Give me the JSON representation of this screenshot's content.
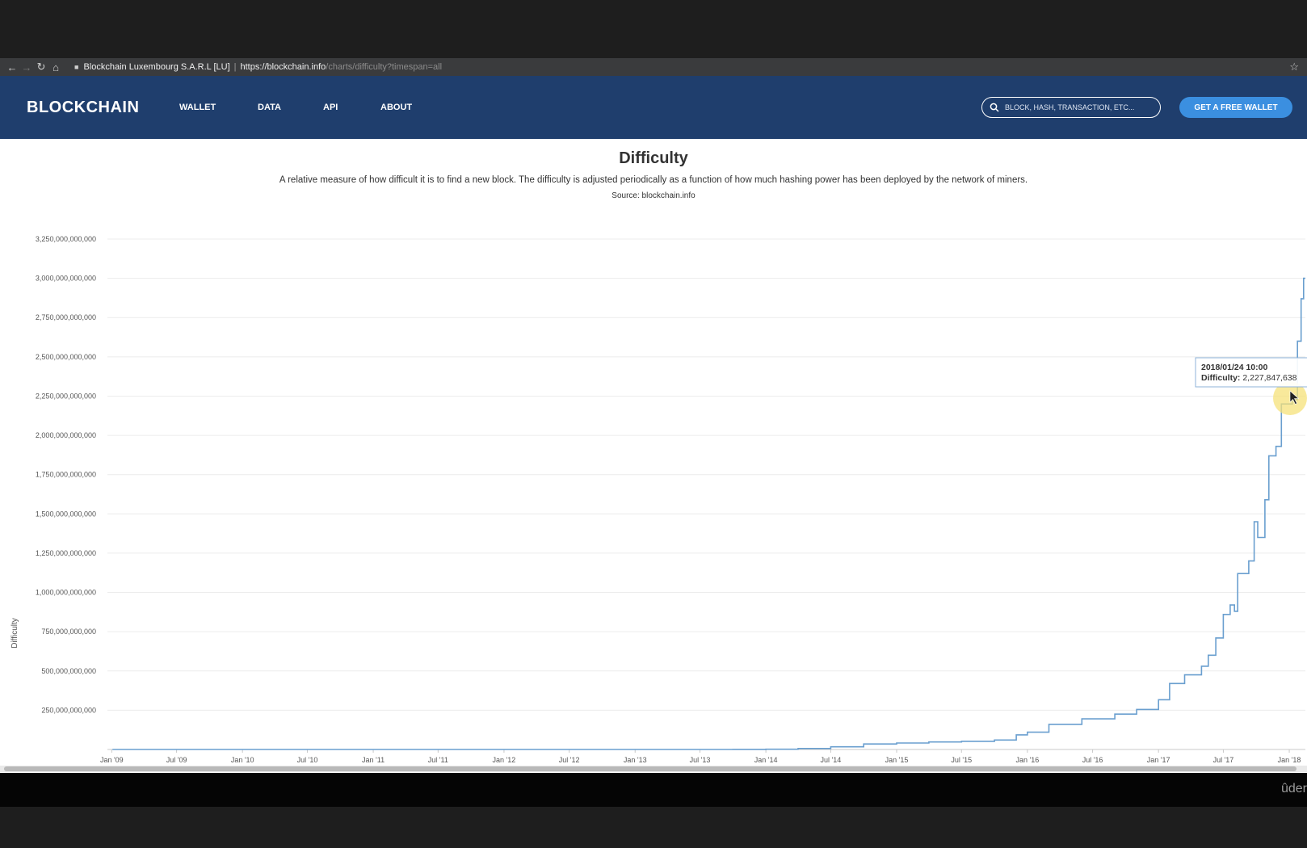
{
  "browser": {
    "site_identity": "Blockchain Luxembourg S.A.R.L [LU]",
    "url_host": "https://blockchain.info",
    "url_path": "/charts/difficulty?timespan=all",
    "back_icon": "arrow-left-icon",
    "forward_icon": "arrow-right-icon",
    "reload_icon": "reload-icon",
    "home_icon": "home-icon",
    "bookmark_icon": "star-icon"
  },
  "header": {
    "logo": "BLOCKCHAIN",
    "nav": [
      {
        "label": "WALLET"
      },
      {
        "label": "DATA"
      },
      {
        "label": "API"
      },
      {
        "label": "ABOUT"
      }
    ],
    "search_placeholder": "BLOCK, HASH, TRANSACTION, ETC...",
    "cta_label": "GET A FREE WALLET",
    "colors": {
      "header_bg": "#1f3e6d",
      "cta_bg": "#3b8fe0"
    }
  },
  "page": {
    "title": "Difficulty",
    "description": "A relative measure of how difficult it is to find a new block. The difficulty is adjusted periodically as a function of how much hashing power has been deployed by the network of miners.",
    "source": "Source: blockchain.info"
  },
  "tooltip": {
    "date": "2018/01/24 10:00",
    "label": "Difficulty:",
    "value": "2,227,847,638"
  },
  "footer": {
    "watermark": "ûder"
  },
  "chart_data": {
    "type": "line",
    "title": "Difficulty",
    "ylabel": "Difficulty",
    "xlabel": "",
    "ylim": [
      0,
      3250000000000
    ],
    "xlim": [
      "2008-12-20",
      "2018-02-15"
    ],
    "grid": true,
    "legend": "none",
    "line_color": "#6a9fcf",
    "y_ticks": [
      {
        "value": 250000000000,
        "label": "250,000,000,000"
      },
      {
        "value": 500000000000,
        "label": "500,000,000,000"
      },
      {
        "value": 750000000000,
        "label": "750,000,000,000"
      },
      {
        "value": 1000000000000,
        "label": "1,000,000,000,000"
      },
      {
        "value": 1250000000000,
        "label": "1,250,000,000,000"
      },
      {
        "value": 1500000000000,
        "label": "1,500,000,000,000"
      },
      {
        "value": 1750000000000,
        "label": "1,750,000,000,000"
      },
      {
        "value": 2000000000000,
        "label": "2,000,000,000,000"
      },
      {
        "value": 2250000000000,
        "label": "2,250,000,000,000"
      },
      {
        "value": 2500000000000,
        "label": "2,500,000,000,000"
      },
      {
        "value": 2750000000000,
        "label": "2,750,000,000,000"
      },
      {
        "value": 3000000000000,
        "label": "3,000,000,000,000"
      },
      {
        "value": 3250000000000,
        "label": "3,250,000,000,000"
      }
    ],
    "x_ticks": [
      {
        "date": "2009-01-01",
        "label": "Jan '09"
      },
      {
        "date": "2009-07-01",
        "label": "Jul '09"
      },
      {
        "date": "2010-01-01",
        "label": "Jan '10"
      },
      {
        "date": "2010-07-01",
        "label": "Jul '10"
      },
      {
        "date": "2011-01-01",
        "label": "Jan '11"
      },
      {
        "date": "2011-07-01",
        "label": "Jul '11"
      },
      {
        "date": "2012-01-01",
        "label": "Jan '12"
      },
      {
        "date": "2012-07-01",
        "label": "Jul '12"
      },
      {
        "date": "2013-01-01",
        "label": "Jan '13"
      },
      {
        "date": "2013-07-01",
        "label": "Jul '13"
      },
      {
        "date": "2014-01-01",
        "label": "Jan '14"
      },
      {
        "date": "2014-07-01",
        "label": "Jul '14"
      },
      {
        "date": "2015-01-01",
        "label": "Jan '15"
      },
      {
        "date": "2015-07-01",
        "label": "Jul '15"
      },
      {
        "date": "2016-01-01",
        "label": "Jan '16"
      },
      {
        "date": "2016-07-01",
        "label": "Jul '16"
      },
      {
        "date": "2017-01-01",
        "label": "Jan '17"
      },
      {
        "date": "2017-07-01",
        "label": "Jul '17"
      },
      {
        "date": "2018-01-01",
        "label": "Jan '18"
      }
    ],
    "series": [
      {
        "points": [
          [
            "2009-01-03",
            1
          ],
          [
            "2011-01-01",
            15000
          ],
          [
            "2012-01-01",
            1300000
          ],
          [
            "2013-01-01",
            3400000
          ],
          [
            "2013-07-01",
            26000000
          ],
          [
            "2013-10-01",
            270000000
          ],
          [
            "2014-01-01",
            1400000000
          ],
          [
            "2014-04-01",
            6100000000
          ],
          [
            "2014-07-01",
            17000000000
          ],
          [
            "2014-10-01",
            35000000000
          ],
          [
            "2015-01-01",
            41000000000
          ],
          [
            "2015-04-01",
            48000000000
          ],
          [
            "2015-07-01",
            52000000000
          ],
          [
            "2015-10-01",
            60000000000
          ],
          [
            "2015-12-01",
            93000000000
          ],
          [
            "2016-01-01",
            110000000000
          ],
          [
            "2016-03-01",
            160000000000
          ],
          [
            "2016-06-01",
            195000000000
          ],
          [
            "2016-09-01",
            225000000000
          ],
          [
            "2016-11-01",
            255000000000
          ],
          [
            "2017-01-01",
            317000000000
          ],
          [
            "2017-02-01",
            420000000000
          ],
          [
            "2017-03-15",
            475000000000
          ],
          [
            "2017-05-01",
            530000000000
          ],
          [
            "2017-05-20",
            600000000000
          ],
          [
            "2017-06-10",
            710000000000
          ],
          [
            "2017-07-01",
            860000000000
          ],
          [
            "2017-07-20",
            920000000000
          ],
          [
            "2017-08-01",
            880000000000
          ],
          [
            "2017-08-10",
            1120000000000
          ],
          [
            "2017-09-10",
            1200000000000
          ],
          [
            "2017-09-25",
            1450000000000
          ],
          [
            "2017-10-05",
            1350000000000
          ],
          [
            "2017-10-25",
            1590000000000
          ],
          [
            "2017-11-05",
            1870000000000
          ],
          [
            "2017-11-25",
            1930000000000
          ],
          [
            "2017-12-10",
            2200000000000
          ],
          [
            "2018-01-10",
            2227847638000
          ],
          [
            "2018-01-24",
            2600000000000
          ],
          [
            "2018-02-03",
            2870000000000
          ],
          [
            "2018-02-10",
            3000000000000
          ]
        ]
      }
    ]
  }
}
